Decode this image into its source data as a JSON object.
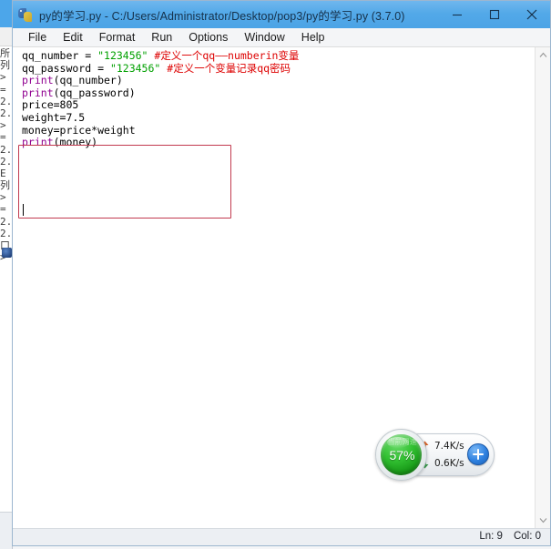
{
  "window": {
    "title": "py的学习.py - C:/Users/Administrator/Desktop/pop3/py的学习.py (3.7.0)",
    "icon": "python-idle-icon",
    "controls": {
      "minimize": "minimize-icon",
      "maximize": "maximize-icon",
      "close": "close-icon"
    }
  },
  "menubar": {
    "items": [
      {
        "label": "File"
      },
      {
        "label": "Edit"
      },
      {
        "label": "Format"
      },
      {
        "label": "Run"
      },
      {
        "label": "Options"
      },
      {
        "label": "Window"
      },
      {
        "label": "Help"
      }
    ]
  },
  "editor": {
    "lines": [
      {
        "segments": [
          {
            "text": "qq_number = ",
            "type": "plain"
          },
          {
            "text": "\"123456\"",
            "type": "string"
          },
          {
            "text": " ",
            "type": "plain"
          },
          {
            "text": "#定义一个qq——numberin变量",
            "type": "comment"
          }
        ]
      },
      {
        "segments": [
          {
            "text": "qq_password = ",
            "type": "plain"
          },
          {
            "text": "\"123456\"",
            "type": "string"
          },
          {
            "text": " ",
            "type": "plain"
          },
          {
            "text": "#定义一个变量记录qq密码",
            "type": "comment"
          }
        ]
      },
      {
        "segments": [
          {
            "text": "print",
            "type": "builtin"
          },
          {
            "text": "(qq_number)",
            "type": "plain"
          }
        ]
      },
      {
        "segments": [
          {
            "text": "print",
            "type": "builtin"
          },
          {
            "text": "(qq_password)",
            "type": "plain"
          }
        ]
      },
      {
        "segments": [
          {
            "text": "price=805",
            "type": "plain"
          }
        ]
      },
      {
        "segments": [
          {
            "text": "weight=7.5",
            "type": "plain"
          }
        ]
      },
      {
        "segments": [
          {
            "text": "money=price*weight",
            "type": "plain"
          }
        ]
      },
      {
        "segments": [
          {
            "text": "print",
            "type": "builtin"
          },
          {
            "text": "(money)",
            "type": "plain"
          }
        ]
      }
    ],
    "annotation_box_color": "#c23a4f",
    "colors": {
      "string": "#00a000",
      "comment": "#dd0000",
      "builtin": "#900090",
      "plain": "#000000"
    }
  },
  "statusbar": {
    "line_label": "Ln: 9",
    "col_label": "Col: 0"
  },
  "net_widget": {
    "orb_label": "当前网速",
    "percent": "57%",
    "upload": "7.4K/s",
    "download": "0.6K/s",
    "upload_icon": "upload-arrow-icon",
    "download_icon": "download-arrow-icon",
    "expand_icon": "plus-icon",
    "upload_color": "#d4632a",
    "download_color": "#3a9a4e",
    "orb_color": "#33c233"
  },
  "bg_window": {
    "sliver_lines": [
      "所",
      "列",
      ">",
      "=",
      "2.",
      "2.",
      ">",
      "=",
      "2.",
      "2.",
      "E",
      "列",
      ">",
      "=",
      "2.",
      "2.",
      "口",
      ">"
    ]
  }
}
